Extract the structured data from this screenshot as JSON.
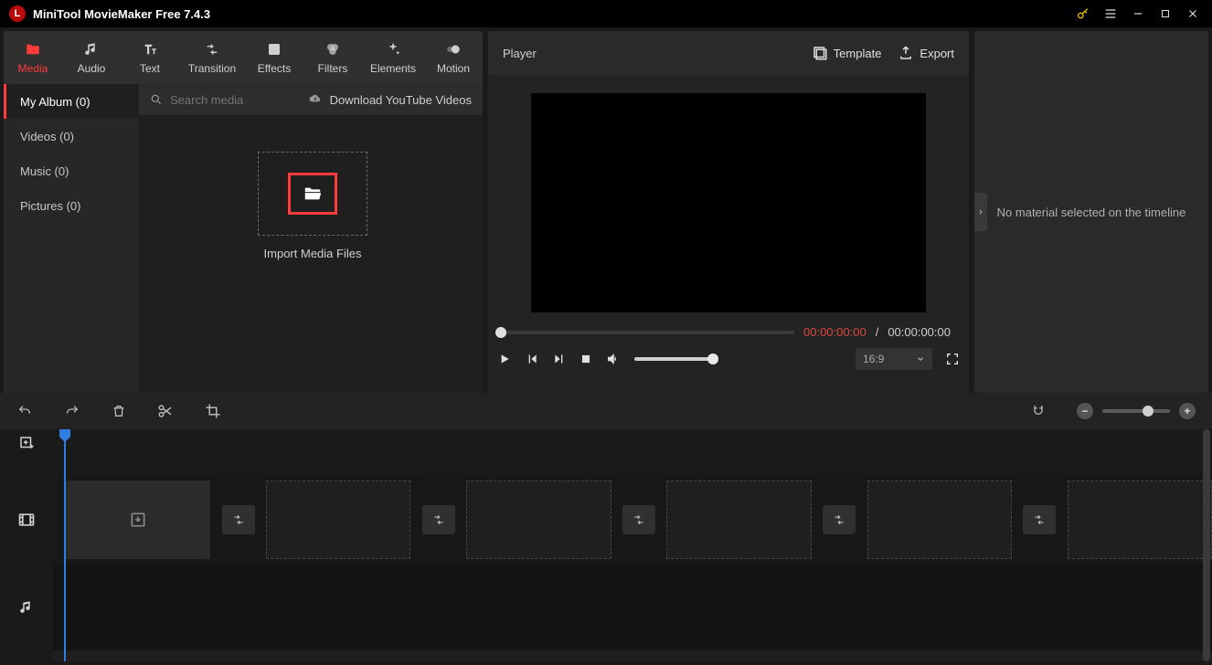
{
  "titlebar": {
    "title": "MiniTool MovieMaker Free 7.4.3"
  },
  "tabs": [
    {
      "label": "Media"
    },
    {
      "label": "Audio"
    },
    {
      "label": "Text"
    },
    {
      "label": "Transition"
    },
    {
      "label": "Effects"
    },
    {
      "label": "Filters"
    },
    {
      "label": "Elements"
    },
    {
      "label": "Motion"
    }
  ],
  "sidebar": {
    "items": [
      {
        "label": "My Album (0)"
      },
      {
        "label": "Videos (0)"
      },
      {
        "label": "Music (0)"
      },
      {
        "label": "Pictures (0)"
      }
    ]
  },
  "search": {
    "placeholder": "Search media"
  },
  "download_yt": "Download YouTube Videos",
  "import_label": "Import Media Files",
  "player": {
    "title": "Player",
    "template": "Template",
    "export": "Export",
    "time_current": "00:00:00:00",
    "time_sep": "/",
    "time_total": "00:00:00:00",
    "ratio": "16:9"
  },
  "props": {
    "empty": "No material selected on the timeline"
  }
}
